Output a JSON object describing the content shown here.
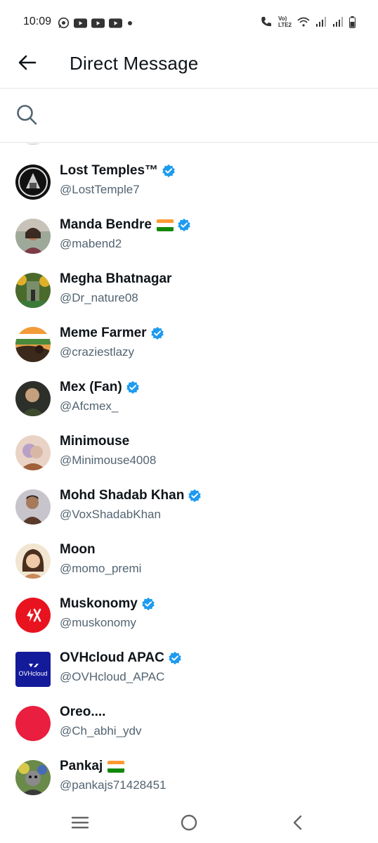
{
  "status_bar": {
    "time": "10:09",
    "left_icons": [
      "whatsapp-icon",
      "youtube-icon",
      "youtube-icon",
      "youtube-icon",
      "dot-icon"
    ],
    "right_icons": [
      "volte-call-icon",
      "wifi-icon",
      "signal-icon",
      "signal-icon",
      "battery-icon"
    ],
    "network_label_top": "Vo)",
    "network_label_bottom": "LTE2"
  },
  "header": {
    "title": "Direct Message",
    "back_icon": "arrow-left-icon"
  },
  "search": {
    "icon": "search-icon",
    "value": "",
    "placeholder": ""
  },
  "colors": {
    "verified": "#1d9bf0",
    "handle": "#536471",
    "divider": "#e1e6ea"
  },
  "contacts": [
    {
      "name": "Lost Temples™",
      "handle": "@LostTemple7",
      "verified": true,
      "flag": false
    },
    {
      "name": "Manda Bendre",
      "handle": "@mabend2",
      "verified": true,
      "flag": true
    },
    {
      "name": "Megha Bhatnagar",
      "handle": "@Dr_nature08",
      "verified": false,
      "flag": false
    },
    {
      "name": "Meme Farmer",
      "handle": "@craziestlazy",
      "verified": true,
      "flag": false
    },
    {
      "name": "Mex (Fan)",
      "handle": "@Afcmex_",
      "verified": true,
      "flag": false
    },
    {
      "name": "Minimouse",
      "handle": "@Minimouse4008",
      "verified": false,
      "flag": false
    },
    {
      "name": "Mohd Shadab Khan",
      "handle": "@VoxShadabKhan",
      "verified": true,
      "flag": false
    },
    {
      "name": "Moon",
      "handle": "@momo_premi",
      "verified": false,
      "flag": false
    },
    {
      "name": "Muskonomy",
      "handle": "@muskonomy",
      "verified": true,
      "flag": false
    },
    {
      "name": "OVHcloud APAC",
      "handle": "@OVHcloud_APAC",
      "verified": true,
      "flag": false
    },
    {
      "name": "Oreo....",
      "handle": "@Ch_abhi_ydv",
      "verified": false,
      "flag": false
    },
    {
      "name": "Pankaj",
      "handle": "@pankajs71428451",
      "verified": false,
      "flag": true
    }
  ],
  "avatar_labels": {
    "ovhcloud": "OVHcloud"
  },
  "nav_bar": {
    "icons": [
      "menu-icon",
      "home-circle-icon",
      "back-chevron-icon"
    ]
  }
}
